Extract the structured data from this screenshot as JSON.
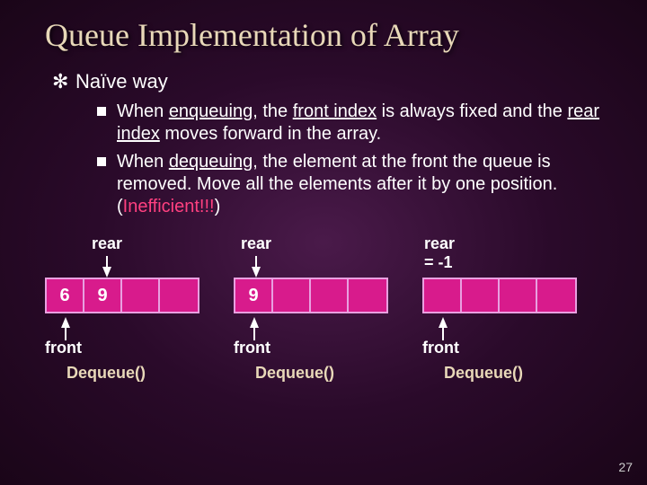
{
  "title": "Queue Implementation of Array",
  "level1": {
    "label": "Naïve way"
  },
  "bullets": {
    "b1_pre": "When ",
    "b1_em": "enqueuing",
    "b1_mid1": ", the ",
    "b1_u1": "front index",
    "b1_mid2": " is always fixed and the ",
    "b1_u2": "rear index",
    "b1_post": " moves forward in the array.",
    "b2_pre": "When ",
    "b2_em": "dequeuing",
    "b2_mid": ", the element at the front the queue is removed. Move all the elements after it by one position. (",
    "b2_red": "Inefficient!!!",
    "b2_post": ")"
  },
  "labels": {
    "rear": "rear",
    "rear_neg1": "rear = -1",
    "front": "front",
    "dequeue": "Dequeue()"
  },
  "diagram1": {
    "c0": "6",
    "c1": "9",
    "c2": "",
    "c3": ""
  },
  "diagram2": {
    "c0": "9",
    "c1": "",
    "c2": "",
    "c3": ""
  },
  "diagram3": {
    "c0": "",
    "c1": "",
    "c2": "",
    "c3": ""
  },
  "page": "27"
}
